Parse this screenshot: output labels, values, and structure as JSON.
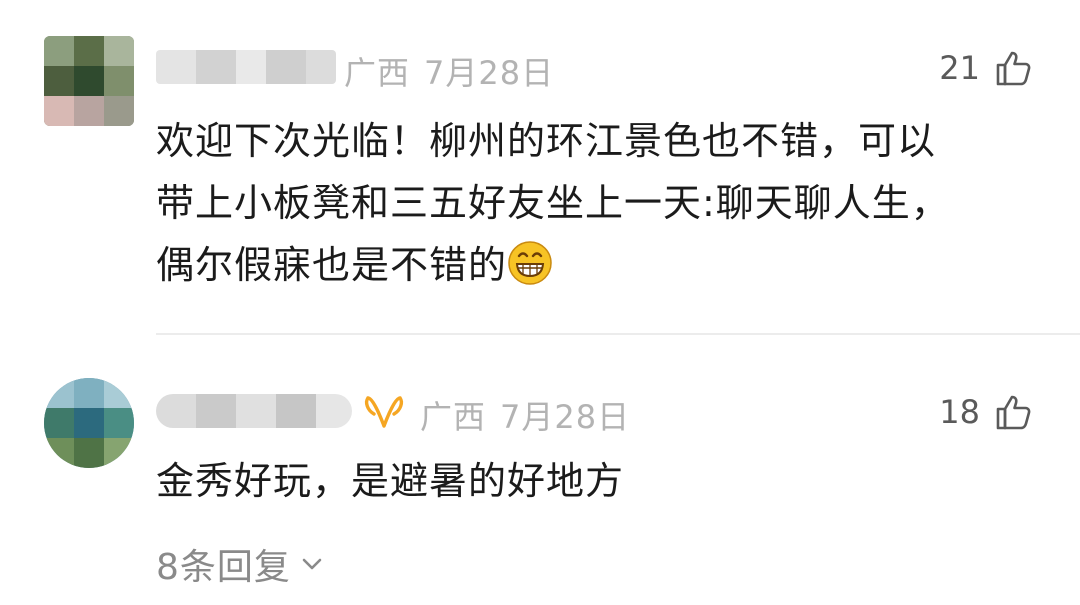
{
  "comments": [
    {
      "location": "广西",
      "date": "7月28日",
      "likes": "21",
      "text_lines": [
        "欢迎下次光临！柳州的环江景色也不错，可以",
        "带上小板凳和三五好友坐上一天:聊天聊人生，",
        "偶尔假寐也是不错的"
      ],
      "emoji": "grinning-face-icon"
    },
    {
      "location": "广西",
      "date": "7月28日",
      "likes": "18",
      "text": "金秀好玩，是避暑的好地方",
      "badge": "vip-badge-icon",
      "replies_label": "8条回复"
    }
  ],
  "colors": {
    "meta_text": "#b3b3b3",
    "body_text": "#1b1b1b",
    "like_text": "#5a5a5a",
    "vip_badge": "#f5a623",
    "emoji": "#f7c325"
  }
}
